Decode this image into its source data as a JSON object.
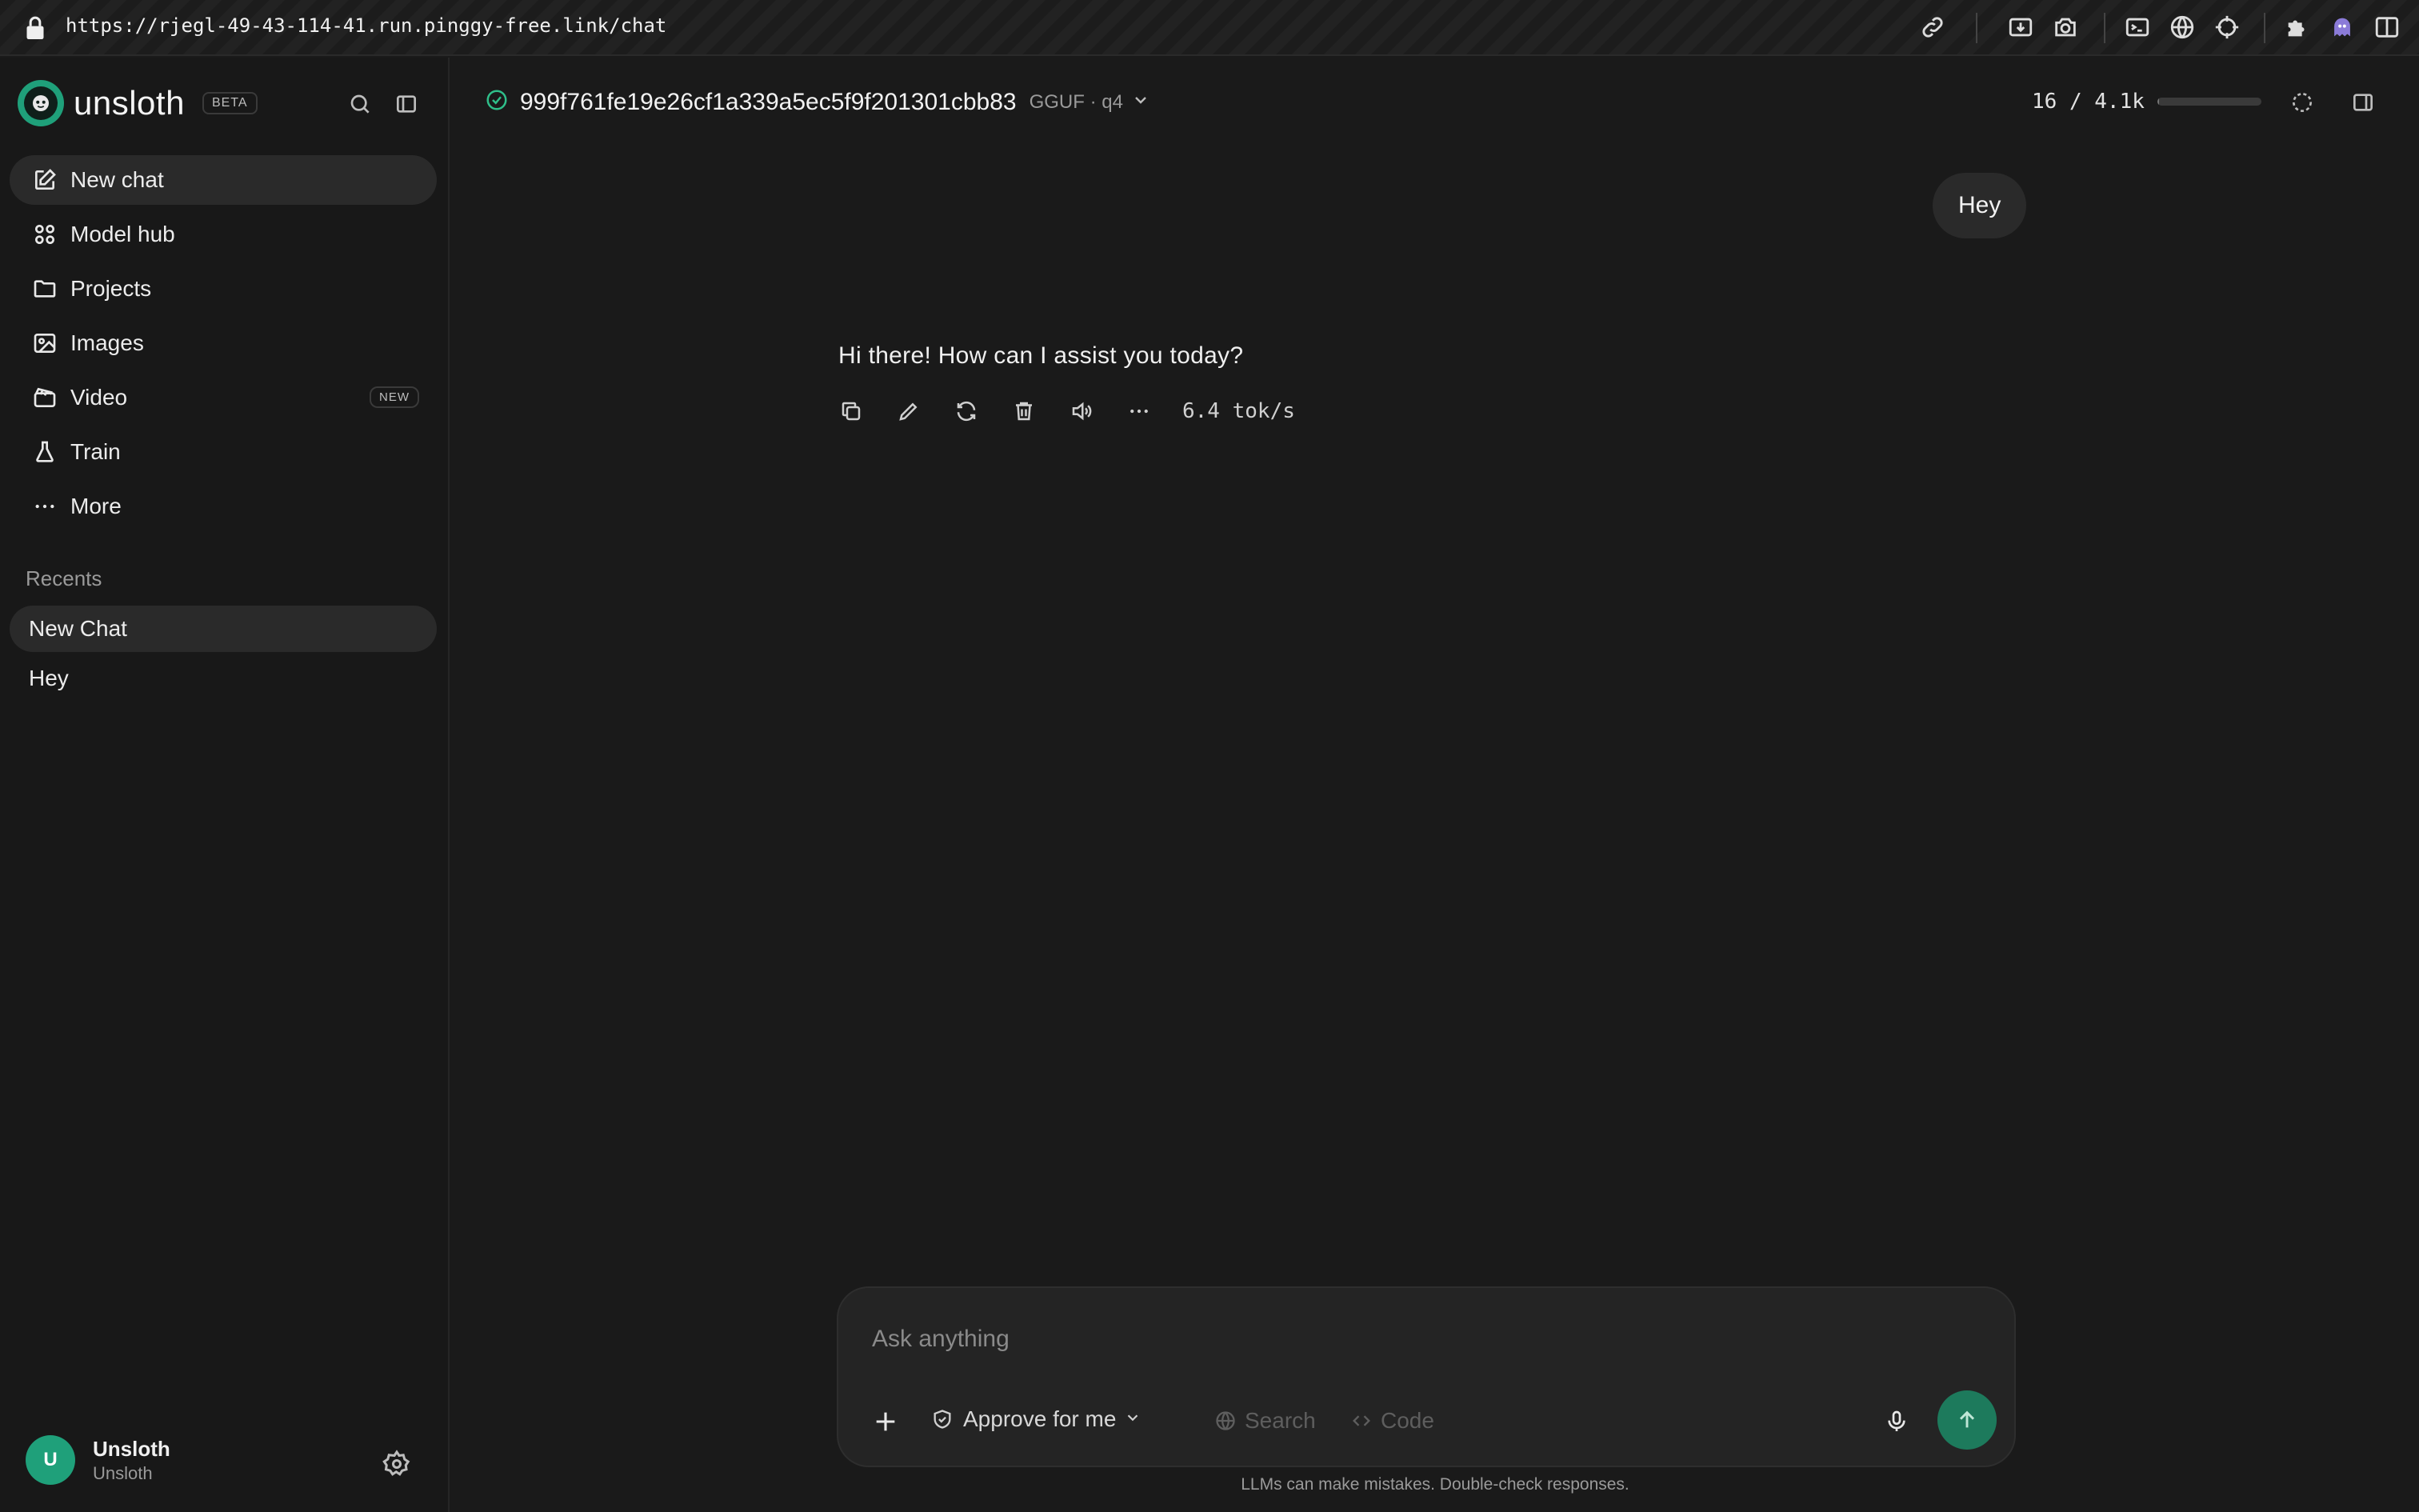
{
  "browser": {
    "url": "https://rjegl-49-43-114-41.run.pinggy-free.link/chat",
    "extension_icons": [
      "link-icon",
      "download-screenshot-icon",
      "camera-icon",
      "terminal-icon",
      "globe-icon",
      "crosshair-icon",
      "puzzle-icon",
      "ghost-icon",
      "sidebar-toggle-icon"
    ]
  },
  "sidebar": {
    "brand": "unsloth",
    "beta_badge": "BETA",
    "nav": [
      {
        "label": "New chat",
        "icon": "edit-icon",
        "active": true
      },
      {
        "label": "Model hub",
        "icon": "grid-icon"
      },
      {
        "label": "Projects",
        "icon": "folder-icon"
      },
      {
        "label": "Images",
        "icon": "image-icon"
      },
      {
        "label": "Video",
        "icon": "video-icon",
        "badge": "NEW"
      },
      {
        "label": "Train",
        "icon": "flask-icon"
      },
      {
        "label": "More",
        "icon": "more-icon"
      }
    ],
    "recents_title": "Recents",
    "recents": [
      {
        "label": "New Chat",
        "active": true
      },
      {
        "label": "Hey"
      }
    ],
    "user": {
      "initial": "U",
      "name": "Unsloth",
      "sub": "Unsloth"
    }
  },
  "header": {
    "model_name": "999f761fe19e26cf1a339a5ec5f9f201301cbb83",
    "model_meta": "GGUF · q4",
    "context_usage": "16 / 4.1k",
    "context_fraction": 0.004
  },
  "conversation": {
    "user_message": "Hey",
    "assistant_message": "Hi there! How can I assist you today?",
    "speed": "6.4 tok/s"
  },
  "composer": {
    "placeholder": "Ask anything",
    "approve_label": "Approve for me",
    "search_label": "Search",
    "code_label": "Code"
  },
  "disclaimer": "LLMs can make mistakes. Double-check responses.",
  "colors": {
    "accent": "#1fa07a",
    "send": "#1d7a5c",
    "background": "#1a1a1a",
    "sidebar": "#181818"
  }
}
